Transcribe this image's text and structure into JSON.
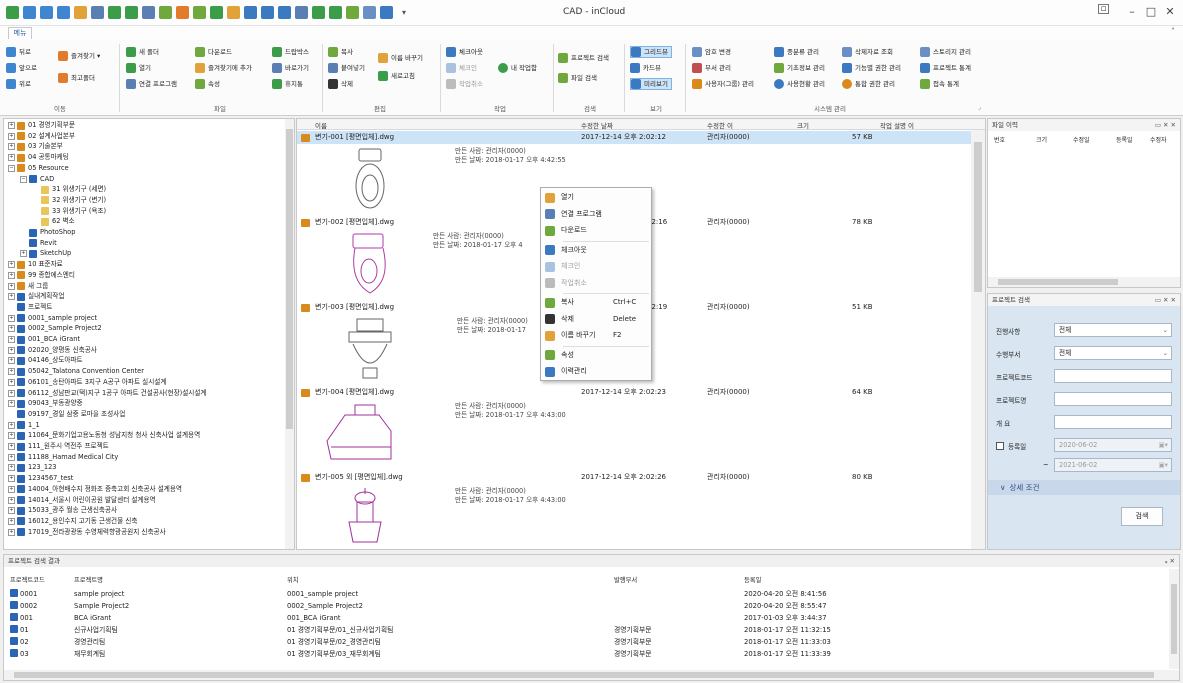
{
  "window": {
    "title": "CAD - inCloud"
  },
  "tabs": {
    "file": "메뉴"
  },
  "ribbon": {
    "groups": [
      {
        "label": "이동"
      },
      {
        "label": "파일"
      },
      {
        "label": "편집"
      },
      {
        "label": "작업"
      },
      {
        "label": "검색"
      },
      {
        "label": "보기"
      },
      {
        "label": "시스템 관리"
      }
    ],
    "buttons": {
      "back": "뒤로",
      "forward": "앞으로",
      "up": "위로",
      "favorites": "즐겨찾기 ▾",
      "up_folder": "최고폴더",
      "new_folder": "새 폴더",
      "open": "열기",
      "open_with": "연결 프로그램",
      "download": "다운로드",
      "add_favorite": "즐겨찾기에 추가",
      "properties": "속성",
      "upload": "드랍박스",
      "shortcut": "바로가기",
      "recycle": "휴지통",
      "copy": "복사",
      "paste": "붙여넣기",
      "delete": "삭제",
      "rename": "이름 바꾸기",
      "refresh": "새로고침",
      "checkout": "체크아웃",
      "checkin": "체크인",
      "cancel_work": "작업취소",
      "my_work": "내 작업함",
      "project_search": "프로젝트 검색",
      "file_search": "파일 검색",
      "view_grid": "그리드뷰",
      "view_card": "카드뷰",
      "view_preview": "미리보기",
      "password": "암호 변경",
      "user_mgmt": "부서 관리",
      "user_group": "사용자(그룹) 관리",
      "org_mgmt": "중분류 관리",
      "base_info": "기초정보 관리",
      "usage": "사용현황 관리",
      "file_quick": "삭제자료 조회",
      "func_auth": "기능별 권한 관리",
      "integrated_auth": "통합 권한 관리",
      "storage": "스토리지 관리",
      "project_stats": "프로젝트 통계",
      "access_stats": "접속 통계"
    }
  },
  "tree": {
    "nodes": [
      {
        "label": "01 경영기획부문",
        "indent": 0,
        "exp": "+",
        "color": "#d98a1c"
      },
      {
        "label": "02 설계사업본부",
        "indent": 0,
        "exp": "+",
        "color": "#d98a1c"
      },
      {
        "label": "03 기술본부",
        "indent": 0,
        "exp": "+",
        "color": "#d98a1c"
      },
      {
        "label": "04 공통마케팅",
        "indent": 0,
        "exp": "+",
        "color": "#d98a1c"
      },
      {
        "label": "05 Resource",
        "indent": 0,
        "exp": "−",
        "color": "#d98a1c"
      },
      {
        "label": "CAD",
        "indent": 1,
        "exp": "−",
        "color": "#2b63b5"
      },
      {
        "label": "31 위생기구 (세면)",
        "indent": 2,
        "exp": "",
        "color": "#e8c65a"
      },
      {
        "label": "32 위생기구 (변기)",
        "indent": 2,
        "exp": "",
        "color": "#e8c65a"
      },
      {
        "label": "33 위생기구 (욕조)",
        "indent": 2,
        "exp": "",
        "color": "#e8c65a"
      },
      {
        "label": "62 벽소",
        "indent": 2,
        "exp": "",
        "color": "#e8c65a"
      },
      {
        "label": "PhotoShop",
        "indent": 1,
        "exp": "",
        "color": "#2b63b5"
      },
      {
        "label": "Revit",
        "indent": 1,
        "exp": "",
        "color": "#2b63b5"
      },
      {
        "label": "SketchUp",
        "indent": 1,
        "exp": "+",
        "color": "#2b63b5"
      },
      {
        "label": "10 표준자료",
        "indent": 0,
        "exp": "+",
        "color": "#d98a1c"
      },
      {
        "label": "99 종합에스엔티",
        "indent": 0,
        "exp": "+",
        "color": "#d98a1c"
      },
      {
        "label": "새 그룹",
        "indent": 0,
        "exp": "+",
        "color": "#d98a1c"
      },
      {
        "label": "실내계획작업",
        "indent": 0,
        "exp": "+",
        "color": "#2b63b5"
      },
      {
        "label": "프로젝트",
        "indent": 0,
        "exp": "",
        "color": "#2b63b5"
      },
      {
        "label": "0001_sample project",
        "indent": 0,
        "exp": "+",
        "color": "#2b63b5"
      },
      {
        "label": "0002_Sample Project2",
        "indent": 0,
        "exp": "+",
        "color": "#2b63b5"
      },
      {
        "label": "001_BCA iGrant",
        "indent": 0,
        "exp": "+",
        "color": "#2b63b5"
      },
      {
        "label": "02020_양평동 신축공사",
        "indent": 0,
        "exp": "+",
        "color": "#2b63b5"
      },
      {
        "label": "04146_상도아파트",
        "indent": 0,
        "exp": "+",
        "color": "#2b63b5"
      },
      {
        "label": "05042_Talatona Convention Center",
        "indent": 0,
        "exp": "+",
        "color": "#2b63b5"
      },
      {
        "label": "06101_송탄아파트 3지구 A공구 아파트 실시설계",
        "indent": 0,
        "exp": "+",
        "color": "#2b63b5"
      },
      {
        "label": "06112_성남판교(택)지구 1공구 아파트 건설공사(현장)설시설계",
        "indent": 0,
        "exp": "+",
        "color": "#2b63b5"
      },
      {
        "label": "09043_부동광양중",
        "indent": 0,
        "exp": "+",
        "color": "#2b63b5"
      },
      {
        "label": "09197_경일 삼중 로마을 조성사업",
        "indent": 0,
        "exp": "",
        "color": "#2b63b5"
      },
      {
        "label": "1_1",
        "indent": 0,
        "exp": "+",
        "color": "#2b63b5"
      },
      {
        "label": "11064_문화기업고용노동청 성남지청 청사 신축사업 설계용역",
        "indent": 0,
        "exp": "+",
        "color": "#2b63b5"
      },
      {
        "label": "111_원주시 역전주 프로젝트",
        "indent": 0,
        "exp": "+",
        "color": "#2b63b5"
      },
      {
        "label": "11188_Hamad Medical City",
        "indent": 0,
        "exp": "+",
        "color": "#2b63b5"
      },
      {
        "label": "123_123",
        "indent": 0,
        "exp": "+",
        "color": "#2b63b5"
      },
      {
        "label": "1234567_test",
        "indent": 0,
        "exp": "+",
        "color": "#2b63b5"
      },
      {
        "label": "14004_아현배수지 정화조 증축고회 신축공사 설계용역",
        "indent": 0,
        "exp": "+",
        "color": "#2b63b5"
      },
      {
        "label": "14014_서울시 어린이공원 발달센터 설계용역",
        "indent": 0,
        "exp": "+",
        "color": "#2b63b5"
      },
      {
        "label": "15033_광주 월송 근생신축공사",
        "indent": 0,
        "exp": "+",
        "color": "#2b63b5"
      },
      {
        "label": "16012_용인수지 고기동 근생건물 신축",
        "indent": 0,
        "exp": "+",
        "color": "#2b63b5"
      },
      {
        "label": "17019_전라광광동 수영체력향광공원지 신축공사",
        "indent": 0,
        "exp": "+",
        "color": "#2b63b5"
      }
    ]
  },
  "filelist": {
    "headers": [
      "이름",
      "수정한 날짜",
      "수정한 이",
      "크기",
      "작업 설명 이"
    ],
    "rows": [
      {
        "name": "변기-001 [평면입체].dwg",
        "date": "2017-12-14 오후 2:02:12",
        "user": "관리자(0000)",
        "size": "57 KB",
        "info1": "만든 사람: 관리자(0000)",
        "info2": "만든 날짜: 2018-01-17 오후 4:42:55"
      },
      {
        "name": "변기-002 [평면입체].dwg",
        "date": "02:16",
        "user": "관리자(0000)",
        "size": "78 KB",
        "info1": "만든 사람: 관리자(0000)",
        "info2": "만든 날짜: 2018-01-17 오후 4"
      },
      {
        "name": "변기-003 [평면입체].dwg",
        "date": "02:19",
        "user": "관리자(0000)",
        "size": "51 KB",
        "info1": "만든 사람: 관리자(0000)",
        "info2": "만든 날짜: 2018-01-17"
      },
      {
        "name": "변기-004 [평면입체].dwg",
        "date": "2017-12-14 오후 2:02:23",
        "user": "관리자(0000)",
        "size": "64 KB",
        "info1": "만든 사람: 관리자(0000)",
        "info2": "만든 날짜: 2018-01-17 오후 4:43:00"
      },
      {
        "name": "변기-005 외 [평면입체].dwg",
        "date": "2017-12-14 오후 2:02:26",
        "user": "관리자(0000)",
        "size": "80 KB",
        "info1": "만든 사람: 관리자(0000)",
        "info2": "만든 날짜: 2018-01-17 오후 4:43:00"
      }
    ]
  },
  "context_menu": {
    "items": [
      {
        "label": "열기",
        "shortcut": "",
        "disabled": false,
        "color": "#e2a23a"
      },
      {
        "label": "연결 프로그램",
        "shortcut": "",
        "disabled": false,
        "color": "#5a7fb5"
      },
      {
        "label": "다운로드",
        "shortcut": "",
        "disabled": false,
        "color": "#6fa83c"
      },
      {
        "label": "체크아웃",
        "shortcut": "",
        "disabled": false,
        "color": "#3b7ac0"
      },
      {
        "label": "체크인",
        "shortcut": "",
        "disabled": true,
        "color": "#a9c2e0"
      },
      {
        "label": "작업취소",
        "shortcut": "",
        "disabled": true,
        "color": "#bbbbbb"
      },
      {
        "label": "복사",
        "shortcut": "Ctrl+C",
        "disabled": false,
        "color": "#6fa83c"
      },
      {
        "label": "삭제",
        "shortcut": "Delete",
        "disabled": false,
        "color": "#333333"
      },
      {
        "label": "이름 바꾸기",
        "shortcut": "F2",
        "disabled": false,
        "color": "#e2a23a"
      },
      {
        "label": "속성",
        "shortcut": "",
        "disabled": false,
        "color": "#6fa83c"
      },
      {
        "label": "이력관리",
        "shortcut": "",
        "disabled": false,
        "color": "#3b7ac0"
      }
    ]
  },
  "right_panel_1": {
    "title": "파일 이력",
    "buttons": "▭ ✕ ✕",
    "columns": [
      "번호",
      "크기",
      "수정일",
      "등록일",
      "수정자"
    ]
  },
  "search_panel": {
    "title": "프로젝트 검색",
    "buttons": "▭ ✕ ✕",
    "fields": [
      {
        "label": "진행사항",
        "value": "전체"
      },
      {
        "label": "수행부서",
        "value": "전체"
      },
      {
        "label": "프로젝트코드",
        "value": ""
      },
      {
        "label": "프로젝트명",
        "value": ""
      },
      {
        "label": "개 요",
        "value": ""
      }
    ],
    "date_label": "등록일",
    "date_from": "2020-06-02",
    "date_tilde": "~",
    "date_to": "2021-06-02",
    "detail": "상세 조건",
    "search_button": "검색"
  },
  "results": {
    "title": "프로젝트 검색 결과",
    "pin": "ᵩ ✕",
    "headers": [
      "프로젝트코드",
      "프로젝트명",
      "위치",
      "발행부서",
      "등록일"
    ],
    "rows": [
      {
        "code": "0001",
        "name": "sample project",
        "path": "0001_sample project",
        "dept": "",
        "date": "2020-04-20 오전 8:41:56"
      },
      {
        "code": "0002",
        "name": "Sample Project2",
        "path": "0002_Sample Project2",
        "dept": "",
        "date": "2020-04-20 오전 8:55:47"
      },
      {
        "code": "001",
        "name": "BCA iGrant",
        "path": "001_BCA iGrant",
        "dept": "",
        "date": "2017-01-03 오후 3:44:37"
      },
      {
        "code": "01",
        "name": "신규사업기획팀",
        "path": "01 경영기획부문/01_신규사업기획팀",
        "dept": "경영기획부문",
        "date": "2018-01-17 오전 11:32:15"
      },
      {
        "code": "02",
        "name": "경영관리팀",
        "path": "01 경영기획부문/02_경영관리팀",
        "dept": "경영기획부문",
        "date": "2018-01-17 오전 11:33:03"
      },
      {
        "code": "03",
        "name": "재무회계팀",
        "path": "01 경영기획부문/03_재무회계팀",
        "dept": "경영기획부문",
        "date": "2018-01-17 오전 11:33:39"
      }
    ]
  }
}
